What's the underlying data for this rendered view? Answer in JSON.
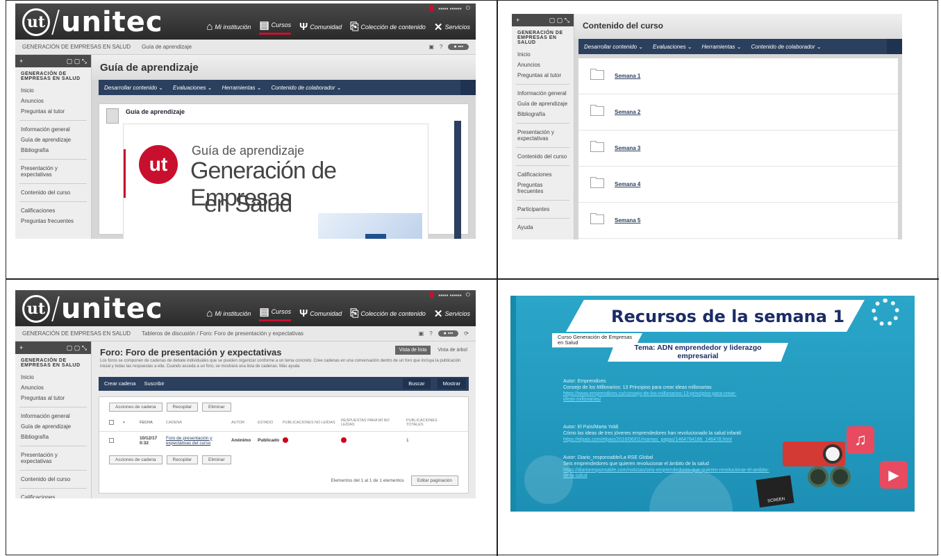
{
  "brand": {
    "name": "unitec",
    "logo_glyph": "ut"
  },
  "nav": [
    "Mi institución",
    "Cursos",
    "Comunidad",
    "Colección de contenido",
    "Servicios"
  ],
  "course_name": "GENERACIÓN DE EMPRESAS EN SALUD",
  "sidebar": {
    "course": "GENERACIÓN DE EMPRESAS EN SALUD",
    "items": [
      "Inicio",
      "Anuncios",
      "Preguntas al tutor",
      "Información general",
      "Guía de aprendizaje",
      "Bibliografía",
      "Presentación y expectativas",
      "Contenido del curso",
      "Calificaciones",
      "Preguntas frecuentes"
    ],
    "items_q2_extra": [
      "Participantes",
      "Ayuda"
    ]
  },
  "menu": [
    "Desarrollar contenido",
    "Evaluaciones",
    "Herramientas",
    "Contenido de colaborador"
  ],
  "q1": {
    "breadcrumb": "Guía de aprendizaje",
    "title": "Guía de aprendizaje",
    "item_link": "Guía de aprendizaje",
    "banner_sub": "Guía de aprendizaje",
    "banner_line1": "Generación de Empresas",
    "banner_line2": "en Salud"
  },
  "q2": {
    "title": "Contenido del curso",
    "weeks": [
      "Semana 1",
      "Semana 2",
      "Semana 3",
      "Semana 4",
      "Semana 5"
    ]
  },
  "q3": {
    "breadcrumb": "Tableros de discusión / Foro: Foro de presentación y expectativas",
    "title": "Foro: Foro de presentación y expectativas",
    "desc": "Los foros se componen de cadenas de debate individuales que se pueden organizar conforme a un tema concreto. Cree cadenas en una conversación dentro de un foro que incluya la publicación inicial y todas las respuestas a ella. Cuando acceda a un foro, se mostrará una lista de cadenas. Más ayuda",
    "view_btn": "Vista de lista",
    "view_link": "Vista de árbol",
    "bar_left": [
      "Crear cadena",
      "Suscribir"
    ],
    "bar_right": [
      "Buscar",
      "Mostrar"
    ],
    "actions": [
      "Acciones de cadena",
      "Recopilar",
      "Eliminar"
    ],
    "headers": [
      "FECHA",
      "CADENA",
      "AUTOR",
      "ESTADO",
      "PUBLICACIONES NO LEÍDAS",
      "RESPUESTAS PARA MÍ NO LEÍDAS",
      "PUBLICACIONES TOTALES"
    ],
    "row": {
      "date": "10/12/17 0:32",
      "thread": "Foro de presentación y expectativas del curso",
      "author": "Anónimo",
      "status": "Publicado",
      "total": "1"
    },
    "pager_text": "Elementos del 1 al 1 de 1 elementos",
    "pager_btn": "Editar paginación"
  },
  "q4": {
    "title": "Recursos de la semana 1",
    "curso": "Curso Generación de Empresas en Salud",
    "tema": "Tema: ADN emprendedor y liderazgo empresarial",
    "refs": [
      {
        "author": "Autor: Emprendices",
        "text": "Consejo de los Millonarios: 13 Principios para crear ideas millonarias",
        "link": "https://www.emprendices.co/consejo-de-los-millonarios-13-principios-para-crear-ideas-millonarias/"
      },
      {
        "author": "Autor: El País/Marta Yoldi",
        "text": "Cómo las ideas de tres jóvenes emprendedores han revolucionado la salud infantil",
        "link": "https://elpais.com/elpais/2016/06/01/mamas_papas/1464784186_146478.html"
      },
      {
        "author": "Autor: Diario_responsable/La RSE Global",
        "text": "Seis emprendedores que quieren revolucionar el ámbito de la salud",
        "link": "https://diarioresponsable.com/noticias/seis-emprendedores-que-quieren-revolucionar-el-ambito-de-la-salud"
      }
    ],
    "clap_text": "SCREEN"
  }
}
